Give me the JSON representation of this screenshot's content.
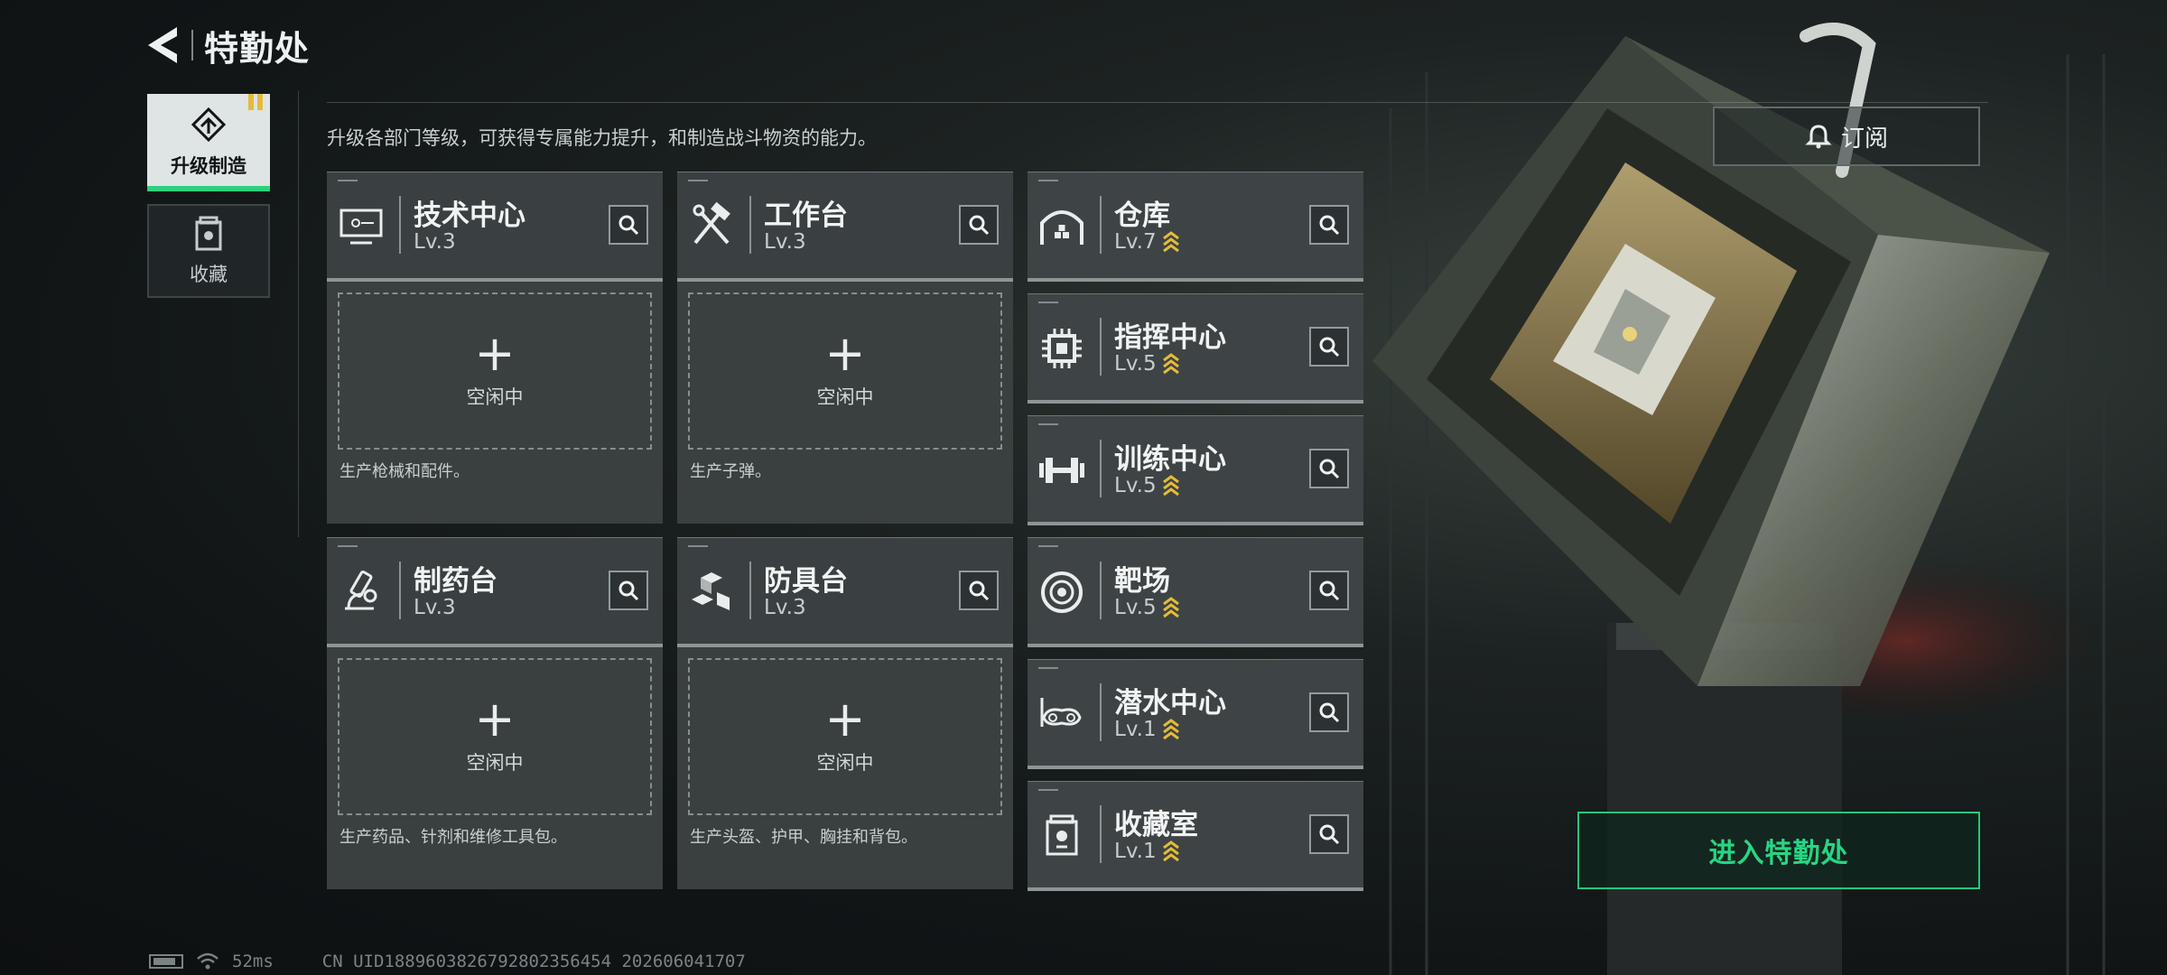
{
  "header": {
    "title": "特勤处"
  },
  "nav": {
    "tabs": [
      {
        "label": "升级制造",
        "icon": "upgrade-icon",
        "active": true
      },
      {
        "label": "收藏",
        "icon": "collection-icon",
        "active": false
      }
    ]
  },
  "description": "升级各部门等级，可获得专属能力提升，和制造战斗物资的能力。",
  "facilities_big": [
    {
      "name": "技术中心",
      "level": "Lv.3",
      "icon": "tech-center-icon",
      "idle_label": "空闲中",
      "production": "生产枪械和配件。"
    },
    {
      "name": "工作台",
      "level": "Lv.3",
      "icon": "workbench-icon",
      "idle_label": "空闲中",
      "production": "生产子弹。"
    },
    {
      "name": "制药台",
      "level": "Lv.3",
      "icon": "pharmacy-icon",
      "idle_label": "空闲中",
      "production": "生产药品、针剂和维修工具包。"
    },
    {
      "name": "防具台",
      "level": "Lv.3",
      "icon": "armor-bench-icon",
      "idle_label": "空闲中",
      "production": "生产头盔、护甲、胸挂和背包。"
    }
  ],
  "facilities_small": [
    {
      "name": "仓库",
      "level": "Lv.7",
      "icon": "warehouse-icon"
    },
    {
      "name": "指挥中心",
      "level": "Lv.5",
      "icon": "command-center-icon"
    },
    {
      "name": "训练中心",
      "level": "Lv.5",
      "icon": "training-center-icon"
    },
    {
      "name": "靶场",
      "level": "Lv.5",
      "icon": "shooting-range-icon"
    },
    {
      "name": "潜水中心",
      "level": "Lv.1",
      "icon": "diving-center-icon"
    },
    {
      "name": "收藏室",
      "level": "Lv.1",
      "icon": "collection-room-icon"
    }
  ],
  "subscribe_label": "订阅",
  "enter_label": "进入特勤处",
  "status": {
    "ping": "52ms",
    "uid": "CN UID1889603826792802356454 202606041707"
  },
  "colors": {
    "accent": "#27d683",
    "rank": "#e4bb3a",
    "card": "#3e4445"
  }
}
